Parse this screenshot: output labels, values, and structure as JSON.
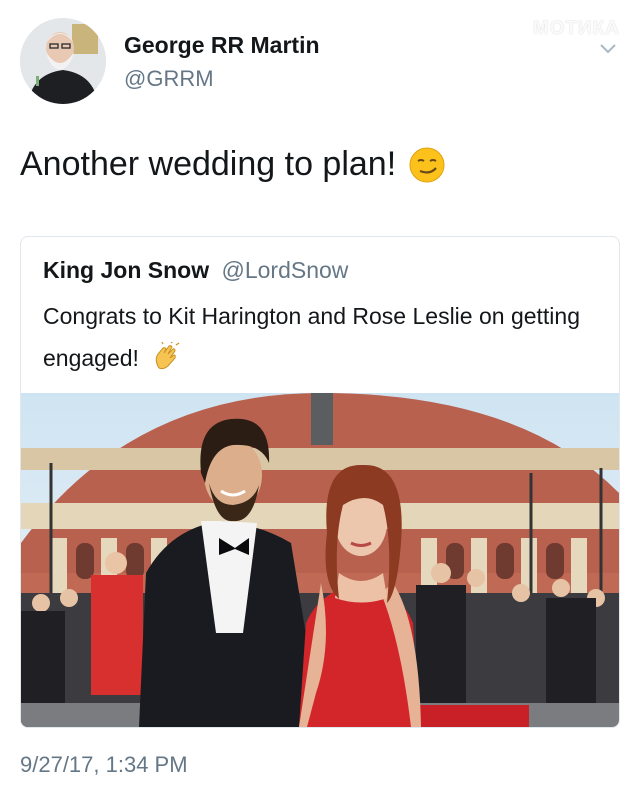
{
  "author": {
    "name": "George RR Martin",
    "handle": "@GRRM"
  },
  "watermark": "МОТИКА",
  "tweet": {
    "text": "Another wedding to plan!",
    "emoji": "smirking-face-icon"
  },
  "quoted_tweet": {
    "name": "King Jon Snow",
    "handle": "@LordSnow",
    "text": "Congrats to Kit Harington and Rose Leslie on getting engaged!",
    "emoji": "clapping-hands-icon"
  },
  "timestamp": "9/27/17, 1:34 PM",
  "colors": {
    "text": "#14171a",
    "secondary": "#657786",
    "border": "#e1e8ed",
    "red_dress": "#d9262d",
    "building_brick": "#b4584a"
  }
}
